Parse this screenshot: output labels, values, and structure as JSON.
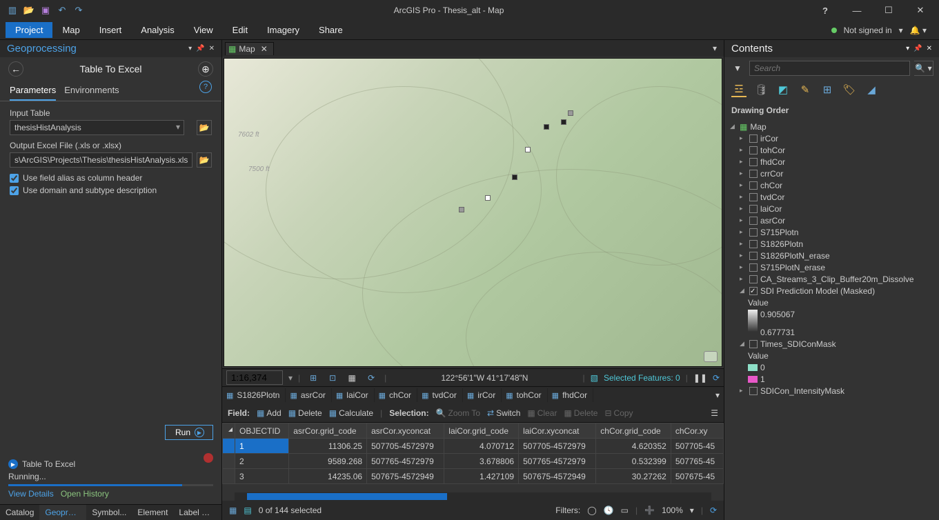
{
  "title": "ArcGIS Pro - Thesis_alt - Map",
  "signin": "Not signed in",
  "tabs": [
    "Project",
    "Map",
    "Insert",
    "Analysis",
    "View",
    "Edit",
    "Imagery",
    "Share"
  ],
  "active_tab": 0,
  "gp": {
    "header": "Geoprocessing",
    "tool": "Table To Excel",
    "subtabs": [
      "Parameters",
      "Environments"
    ],
    "labels": {
      "input": "Input Table",
      "output": "Output Excel File (.xls or .xlsx)"
    },
    "input_value": "thesisHistAnalysis",
    "output_value": "s\\ArcGIS\\Projects\\Thesis\\thesisHistAnalysis.xlsx",
    "check1": "Use field alias as column header",
    "check2": "Use domain and subtype description",
    "run": "Run",
    "status_tool": "Table To Excel",
    "running": "Running...",
    "details": "View Details",
    "history": "Open History"
  },
  "bottom_tabs": [
    "Catalog",
    "Geoproce...",
    "Symbol...",
    "Element",
    "Label Cl..."
  ],
  "map": {
    "tab": "Map",
    "scale": "1:16,374",
    "coord": "122°56'1\"W 41°17'48\"N",
    "sel": "Selected Features: 0"
  },
  "table": {
    "tabs": [
      "S1826Plotn",
      "asrCor",
      "laiCor",
      "chCor",
      "tvdCor",
      "irCor",
      "tohCor",
      "fhdCor"
    ],
    "toolbar": {
      "field": "Field:",
      "add": "Add",
      "delete": "Delete",
      "calc": "Calculate",
      "selection": "Selection:",
      "zoom": "Zoom To",
      "switch": "Switch",
      "clear": "Clear",
      "del2": "Delete",
      "copy": "Copy"
    },
    "cols": [
      "OBJECTID",
      "asrCor.grid_code",
      "asrCor.xyconcat",
      "laiCor.grid_code",
      "laiCor.xyconcat",
      "chCor.grid_code",
      "chCor.xy"
    ],
    "rows": [
      [
        "1",
        "11306.25",
        "507705-4572979",
        "4.070712",
        "507705-4572979",
        "4.620352",
        "507705-45"
      ],
      [
        "2",
        "9589.268",
        "507765-4572979",
        "3.678806",
        "507765-4572979",
        "0.532399",
        "507765-45"
      ],
      [
        "3",
        "14235.06",
        "507675-4572949",
        "1.427109",
        "507675-4572949",
        "30.27262",
        "507675-45"
      ]
    ],
    "status": "0 of 144 selected",
    "filters": "Filters:",
    "zoom": "100%"
  },
  "contents": {
    "header": "Contents",
    "search_ph": "Search",
    "do": "Drawing Order",
    "map_node": "Map",
    "layers": [
      "irCor",
      "tohCor",
      "fhdCor",
      "crrCor",
      "chCor",
      "tvdCor",
      "laiCor",
      "asrCor",
      "S715Plotn",
      "S1826Plotn",
      "S1826PlotN_erase",
      "S715PlotN_erase",
      "CA_Streams_3_Clip_Buffer20m_Dissolve"
    ],
    "sdi": "SDI Prediction Model (Masked)",
    "value": "Value",
    "v1": "0.905067",
    "v2": "0.677731",
    "times": "Times_SDIConMask",
    "tv0": "0",
    "tv1": "1",
    "last": "SDICon_IntensityMask"
  }
}
